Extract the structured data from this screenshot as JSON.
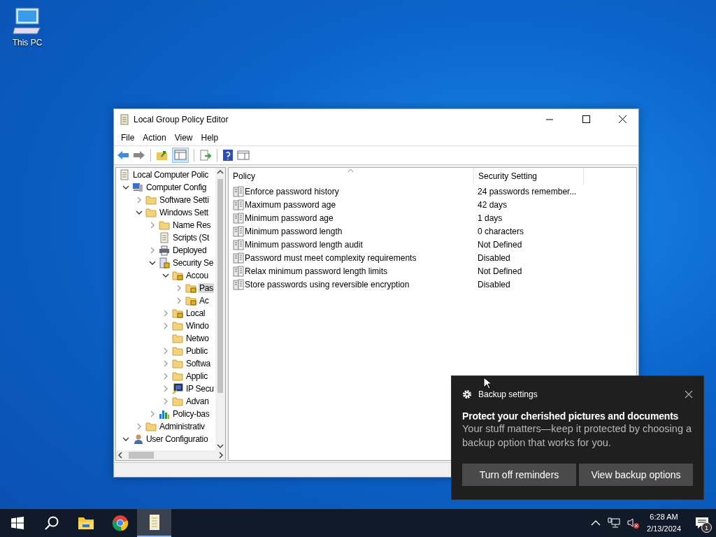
{
  "desktop_icons": [
    {
      "label": "This PC",
      "kind": "computer"
    }
  ],
  "window": {
    "title": "Local Group Policy Editor",
    "menu": [
      "File",
      "Action",
      "View",
      "Help"
    ],
    "tree": [
      {
        "label": "Local Computer Polic",
        "kind": "doc",
        "children": [
          {
            "label": "Computer Config",
            "kind": "computer",
            "expanded": true,
            "children": [
              {
                "label": "Software Setti",
                "kind": "folder",
                "expanded": false
              },
              {
                "label": "Windows Sett",
                "kind": "folder",
                "expanded": true,
                "children": [
                  {
                    "label": "Name Res",
                    "kind": "folder",
                    "expanded": false
                  },
                  {
                    "label": "Scripts (St",
                    "kind": "script"
                  },
                  {
                    "label": "Deployed",
                    "kind": "printer",
                    "expanded": false
                  },
                  {
                    "label": "Security Se",
                    "kind": "security",
                    "expanded": true,
                    "children": [
                      {
                        "label": "Accou",
                        "kind": "lockfolder",
                        "expanded": true,
                        "children": [
                          {
                            "label": "Pas",
                            "kind": "lockfolder",
                            "expanded": false,
                            "selected": true
                          },
                          {
                            "label": "Ac",
                            "kind": "lockfolder",
                            "expanded": false,
                            "selected": false
                          }
                        ]
                      },
                      {
                        "label": "Local",
                        "kind": "lockfolder",
                        "expanded": false
                      },
                      {
                        "label": "Windo",
                        "kind": "folder",
                        "expanded": false
                      },
                      {
                        "label": "Netwo",
                        "kind": "folder"
                      },
                      {
                        "label": "Public",
                        "kind": "folder",
                        "expanded": false
                      },
                      {
                        "label": "Softwa",
                        "kind": "folder",
                        "expanded": false
                      },
                      {
                        "label": "Applic",
                        "kind": "folder",
                        "expanded": false
                      },
                      {
                        "label": "IP Secu",
                        "kind": "ip",
                        "expanded": false
                      },
                      {
                        "label": "Advan",
                        "kind": "folder",
                        "expanded": false
                      }
                    ]
                  },
                  {
                    "label": "Policy-bas",
                    "kind": "chart",
                    "expanded": false
                  }
                ]
              },
              {
                "label": "Administrativ",
                "kind": "folder",
                "expanded": false
              }
            ]
          },
          {
            "label": "User Configuratio",
            "kind": "user",
            "expanded": true
          }
        ]
      }
    ],
    "table": {
      "columns": [
        "Policy",
        "Security Setting"
      ],
      "rows": [
        {
          "policy": "Enforce password history",
          "setting": "24 passwords remember..."
        },
        {
          "policy": "Maximum password age",
          "setting": "42 days"
        },
        {
          "policy": "Minimum password age",
          "setting": "1 days"
        },
        {
          "policy": "Minimum password length",
          "setting": "0 characters"
        },
        {
          "policy": "Minimum password length audit",
          "setting": "Not Defined"
        },
        {
          "policy": "Password must meet complexity requirements",
          "setting": "Disabled"
        },
        {
          "policy": "Relax minimum password length limits",
          "setting": "Not Defined"
        },
        {
          "policy": "Store passwords using reversible encryption",
          "setting": "Disabled"
        }
      ]
    }
  },
  "toast": {
    "app": "Backup settings",
    "heading": "Protect your cherished pictures and documents",
    "body": "Your stuff matters—keep it protected by choosing a backup option that works for you.",
    "buttons": [
      "Turn off reminders",
      "View backup options"
    ]
  },
  "taskbar": {
    "apps": [
      {
        "kind": "start",
        "selected": false
      },
      {
        "kind": "search",
        "selected": false
      },
      {
        "kind": "explorer",
        "selected": false
      },
      {
        "kind": "chrome",
        "selected": false
      },
      {
        "kind": "gpedit",
        "selected": true
      }
    ],
    "time": "6:28 AM",
    "date": "2/13/2024",
    "notifications": "1"
  }
}
